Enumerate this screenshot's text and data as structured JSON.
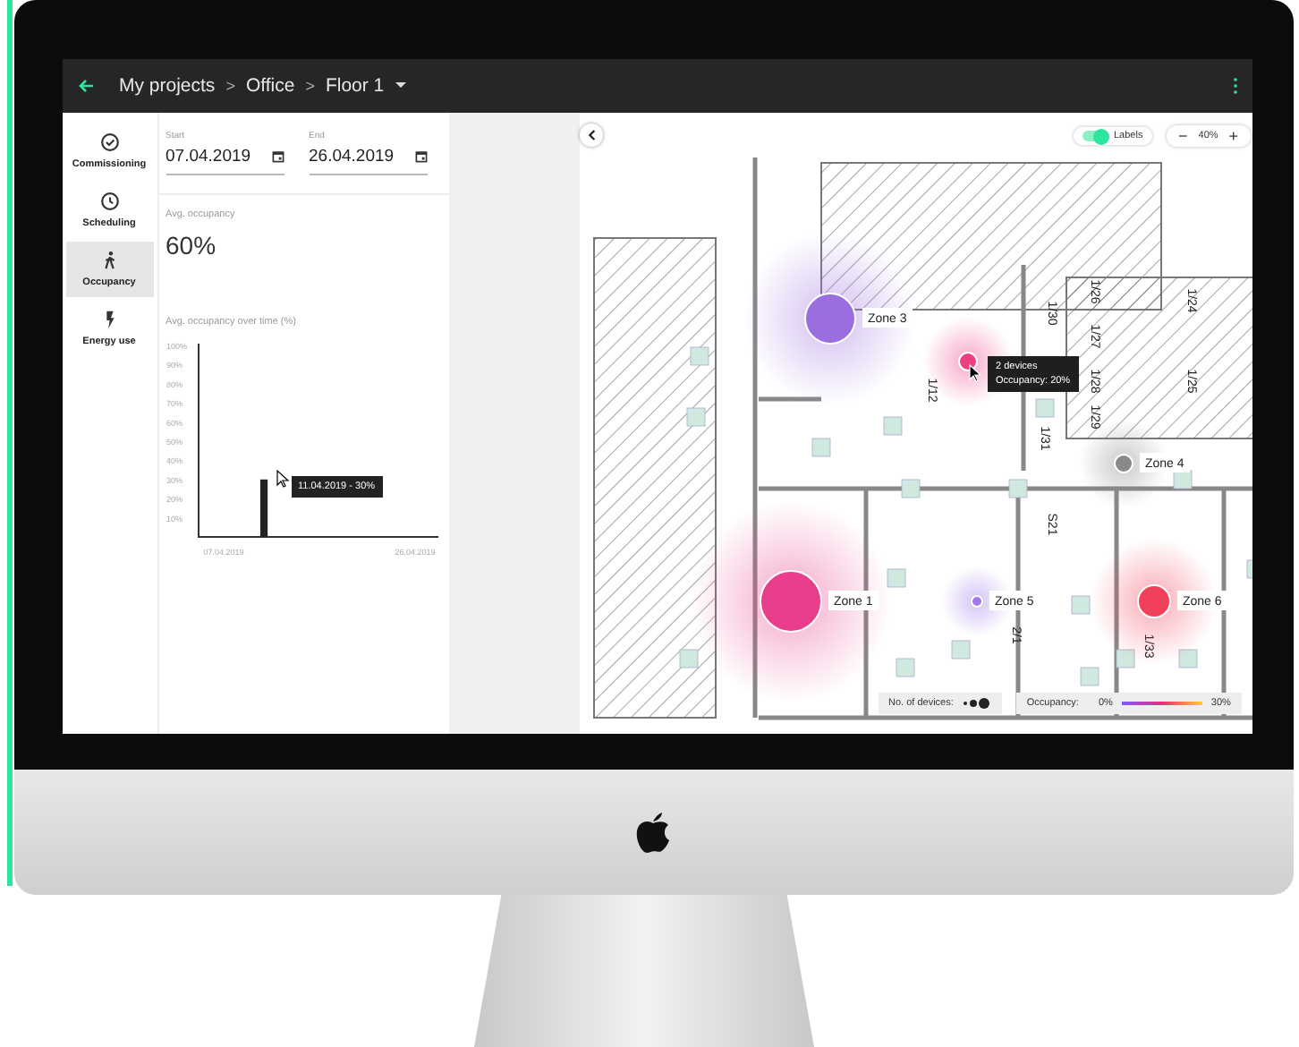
{
  "header": {
    "breadcrumb": [
      "My projects",
      "Office",
      "Floor 1"
    ],
    "separator": ">"
  },
  "nav": [
    {
      "label": "Commissioning",
      "kind": "check",
      "selected": false
    },
    {
      "label": "Scheduling",
      "kind": "clock",
      "selected": false
    },
    {
      "label": "Occupancy",
      "kind": "walk",
      "selected": true
    },
    {
      "label": "Energy use",
      "kind": "bolt",
      "selected": false
    }
  ],
  "dates": [
    {
      "label": "Start",
      "value": "07.04.2019"
    },
    {
      "label": "End",
      "value": "26.04.2019"
    }
  ],
  "avg": {
    "label": "Avg. occupancy",
    "value": "60%"
  },
  "chart": {
    "title": "Avg. occupancy over time (%)",
    "tooltip": "11.04.2019 - 30%",
    "chart_data": {
      "type": "bar",
      "categories": [
        "07.04.2019",
        null,
        null,
        null,
        null,
        null,
        null,
        null,
        null,
        null,
        null,
        null,
        null,
        null,
        null,
        null,
        null,
        null,
        null,
        "26.04.2019"
      ],
      "values": [
        null,
        null,
        null,
        null,
        30,
        null,
        null,
        null,
        null,
        null,
        null,
        null,
        null,
        null,
        null,
        null,
        null,
        null,
        null,
        null
      ],
      "ylim": [
        0,
        100
      ],
      "yticks": [
        {
          "value": 10,
          "label": "10%"
        },
        {
          "value": 20,
          "label": "20%"
        },
        {
          "value": 30,
          "label": "30%"
        },
        {
          "value": 40,
          "label": "40%"
        },
        {
          "value": 50,
          "label": "50%"
        },
        {
          "value": 60,
          "label": "60%"
        },
        {
          "value": 70,
          "label": "70%"
        },
        {
          "value": 80,
          "label": "80%"
        },
        {
          "value": 90,
          "label": "90%"
        },
        {
          "value": 100,
          "label": "100%"
        }
      ]
    }
  },
  "map": {
    "labels_toggle": {
      "label": "Labels",
      "on": true
    },
    "zoom": {
      "minus": "−",
      "value": "40%",
      "plus": "+"
    },
    "rooms": [
      "1/30",
      "1/26",
      "1/27",
      "1/28",
      "1/29",
      "1/24",
      "1/25",
      "1/12",
      "1/31",
      "S21",
      "2/1",
      "1/33"
    ],
    "zones": [
      {
        "label": "Zone 3",
        "color": "#9b6ee0"
      },
      {
        "label": "Zone 4",
        "color": "#8a8a8a"
      },
      {
        "label": "Zone 1",
        "color": "#e83e8c"
      },
      {
        "label": "Zone 5",
        "color": "#a07be8"
      },
      {
        "label": "Zone 6",
        "color": "#f2405a"
      },
      {
        "color": "#ec3f86"
      }
    ],
    "tooltip": [
      "2 devices",
      "Occupancy: 20%"
    ],
    "legend": {
      "devices": "No. of devices:",
      "occupancy": "Occupancy:",
      "min": "0%",
      "max": "30%"
    }
  }
}
